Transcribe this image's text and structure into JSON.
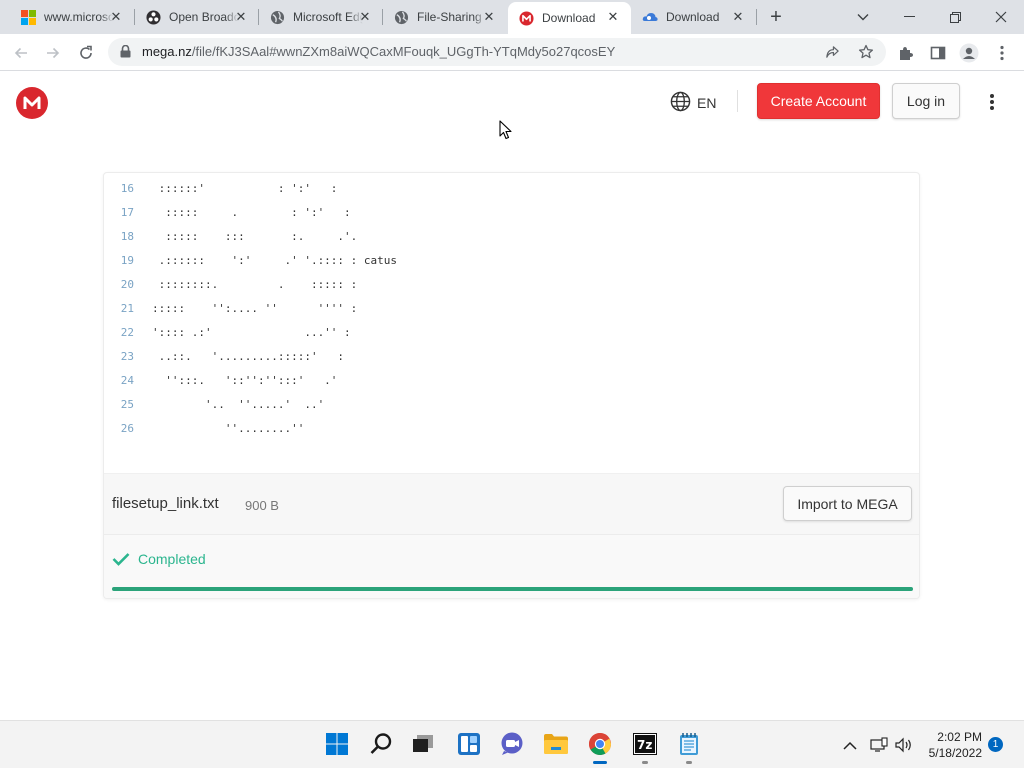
{
  "browser": {
    "tabs": [
      {
        "title": "www.microsoft.com",
        "favicon": "microsoft-logo-icon",
        "active": false
      },
      {
        "title": "Open Broadcaster",
        "favicon": "obs-icon",
        "active": false
      },
      {
        "title": "Microsoft Edge",
        "favicon": "globe-icon",
        "active": false
      },
      {
        "title": "File-Sharing",
        "favicon": "globe-icon",
        "active": false
      },
      {
        "title": "Download",
        "favicon": "mega-icon",
        "active": true
      },
      {
        "title": "Download",
        "favicon": "cloud-icon",
        "active": false
      }
    ],
    "address": {
      "host": "mega.nz",
      "path": "/file/fKJ3SAal#wwnZXm8aiWQCaxMFouqk_UGgTh-YTqMdy5o27qcosEY"
    }
  },
  "header": {
    "language": "EN",
    "create_account": "Create Account",
    "login": "Log in"
  },
  "preview": {
    "lines": [
      {
        "num": "16",
        "text": " ::::::'           : ':'   :"
      },
      {
        "num": "17",
        "text": "  :::::     .        : ':'   :"
      },
      {
        "num": "18",
        "text": "  :::::    :::       :.     .'."
      },
      {
        "num": "19",
        "text": " .::::::    ':'     .' '.:::: : catus"
      },
      {
        "num": "20",
        "text": " ::::::::.         .    ::::: :"
      },
      {
        "num": "21",
        "text": ":::::    '':.... ''      '''' :"
      },
      {
        "num": "22",
        "text": "':::: .:'              ...'' :"
      },
      {
        "num": "23",
        "text": " ..::.   '.........:::::'   :"
      },
      {
        "num": "24",
        "text": "  '':::.   '::'':'':::'   .'"
      },
      {
        "num": "25",
        "text": "        '..  ''.....'  ..'"
      },
      {
        "num": "26",
        "text": "           ''........''"
      }
    ]
  },
  "file": {
    "name": "filesetup_link.txt",
    "size": "900 B",
    "import_label": "Import to MEGA"
  },
  "status": {
    "text": "Completed",
    "progress": 1.0,
    "color": "#2bb58e"
  },
  "taskbar": {
    "apps": [
      "windows-start-icon",
      "search-icon",
      "task-view-icon",
      "widgets-icon",
      "teams-chat-icon",
      "file-explorer-icon",
      "chrome-icon",
      "7zip-icon",
      "notepad-icon"
    ],
    "time": "2:02 PM",
    "date": "5/18/2022",
    "notifications": "1"
  },
  "colors": {
    "mega_red": "#d9272e",
    "create_button": "#f0373a",
    "progress": "#2ba37a"
  }
}
